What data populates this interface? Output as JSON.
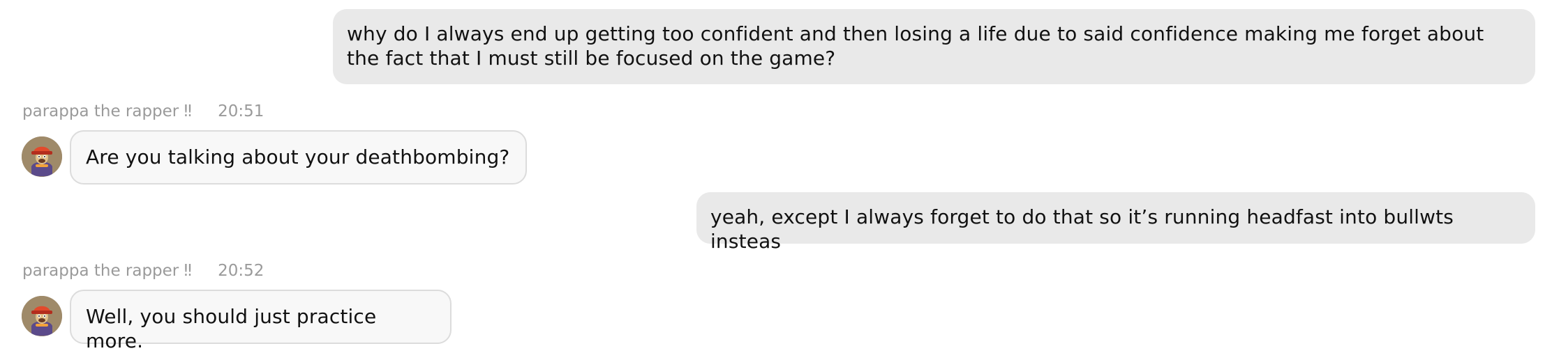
{
  "conversation": {
    "messages": [
      {
        "role": "user",
        "text": "why do I always end up getting too confident and then losing a life due to said confidence making me forget about the fact that I must still be focused on the game?"
      },
      {
        "role": "assistant",
        "sender": "parappa the rapper ‼",
        "time": "20:51",
        "text": "Are you talking about your deathbombing?",
        "avatar_icon": "parappa-avatar-icon"
      },
      {
        "role": "user",
        "text": "yeah, except I always forget to do that so it’s running headfast into bullwts insteas"
      },
      {
        "role": "assistant",
        "sender": "parappa the rapper ‼",
        "time": "20:52",
        "text": "Well, you should just practice more.",
        "avatar_icon": "parappa-avatar-icon"
      }
    ]
  },
  "colors": {
    "page_background": "#ffffff",
    "user_bubble": "#e9e9e9",
    "assistant_bubble": "#f8f8f8",
    "assistant_border": "#dcdcdc",
    "meta_text": "#9a9a9a",
    "message_text": "#111111",
    "avatar_background": "#9f8a69",
    "avatar_hat": "#e24a2c"
  }
}
